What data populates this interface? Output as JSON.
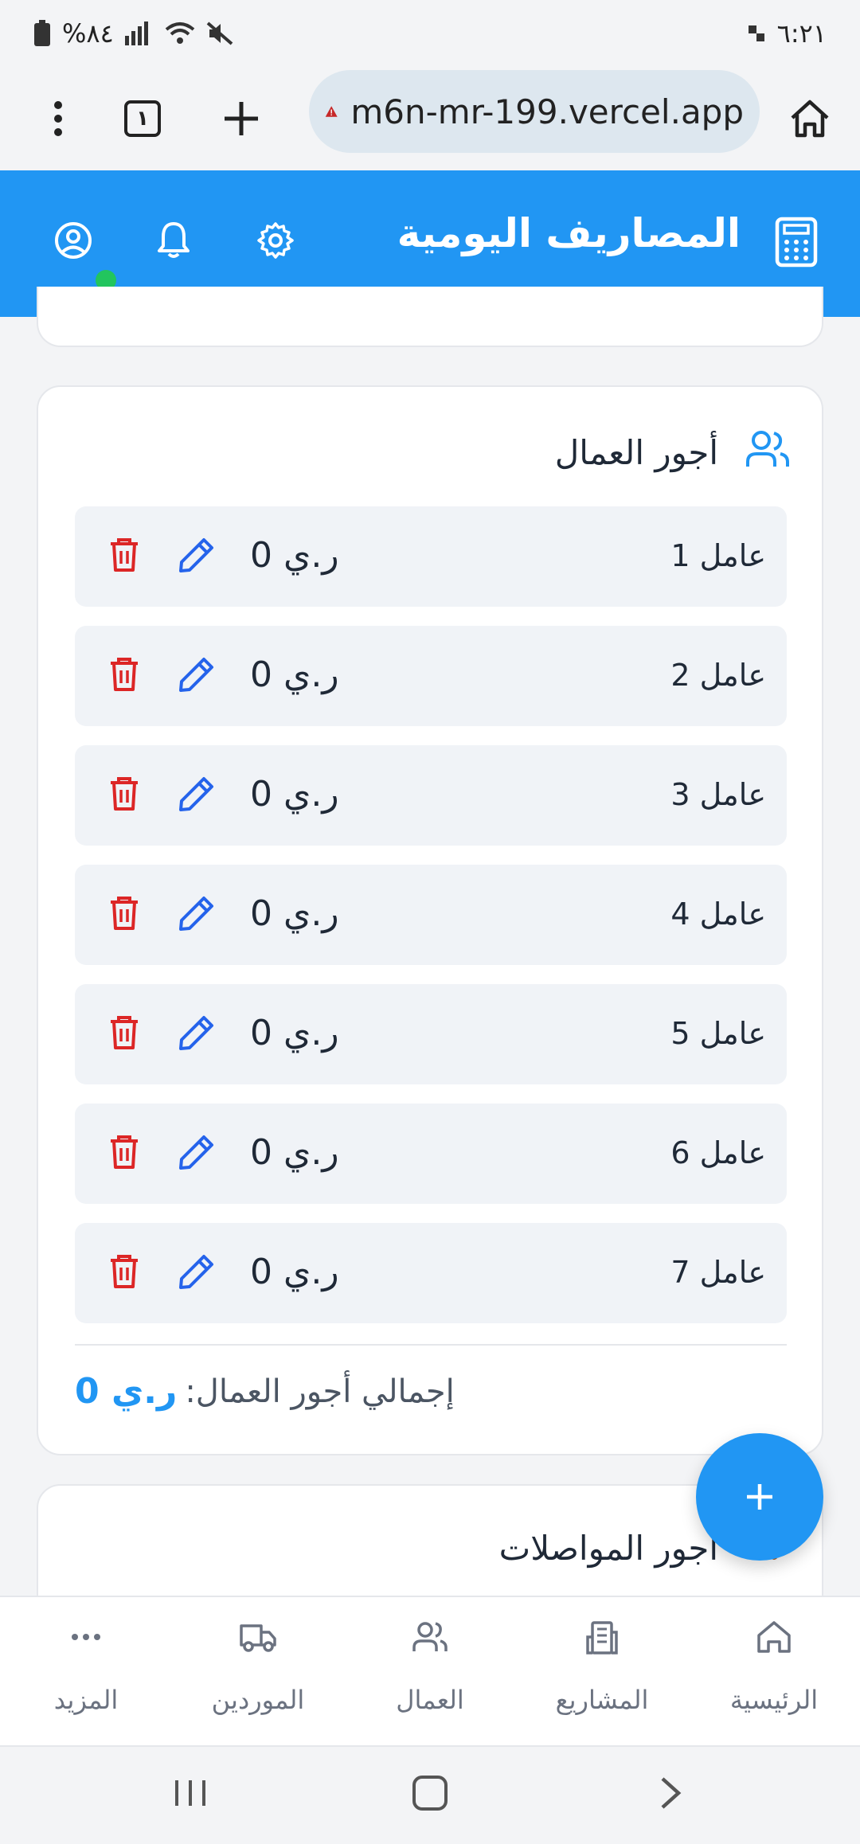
{
  "status_bar": {
    "time": "٦:٢١",
    "battery": "%٨٤"
  },
  "browser": {
    "url": "m6n-mr-199.vercel.app",
    "tab_count": "١"
  },
  "header": {
    "title": "المصاريف اليومية"
  },
  "workers_card": {
    "title": "أجور العمال",
    "rows": [
      {
        "name": "عامل 1",
        "amount": "ر.ي 0"
      },
      {
        "name": "عامل 2",
        "amount": "ر.ي 0"
      },
      {
        "name": "عامل 3",
        "amount": "ر.ي 0"
      },
      {
        "name": "عامل 4",
        "amount": "ر.ي 0"
      },
      {
        "name": "عامل 5",
        "amount": "ر.ي 0"
      },
      {
        "name": "عامل 6",
        "amount": "ر.ي 0"
      },
      {
        "name": "عامل 7",
        "amount": "ر.ي 0"
      }
    ],
    "total_label": "إجمالي أجور العمال:",
    "total_value": "ر.ي 0"
  },
  "transport_card": {
    "title": "أجور المواصلات"
  },
  "fab": {
    "symbol": "+"
  },
  "bottom_nav": [
    {
      "label": "الرئيسية",
      "icon": "home-icon"
    },
    {
      "label": "المشاريع",
      "icon": "building-icon"
    },
    {
      "label": "العمال",
      "icon": "users-icon"
    },
    {
      "label": "الموردين",
      "icon": "truck-icon"
    },
    {
      "label": "المزيد",
      "icon": "more-icon"
    }
  ],
  "colors": {
    "primary": "#2196f3",
    "danger": "#dc2626",
    "edit": "#2563eb",
    "online": "#22c55e"
  }
}
